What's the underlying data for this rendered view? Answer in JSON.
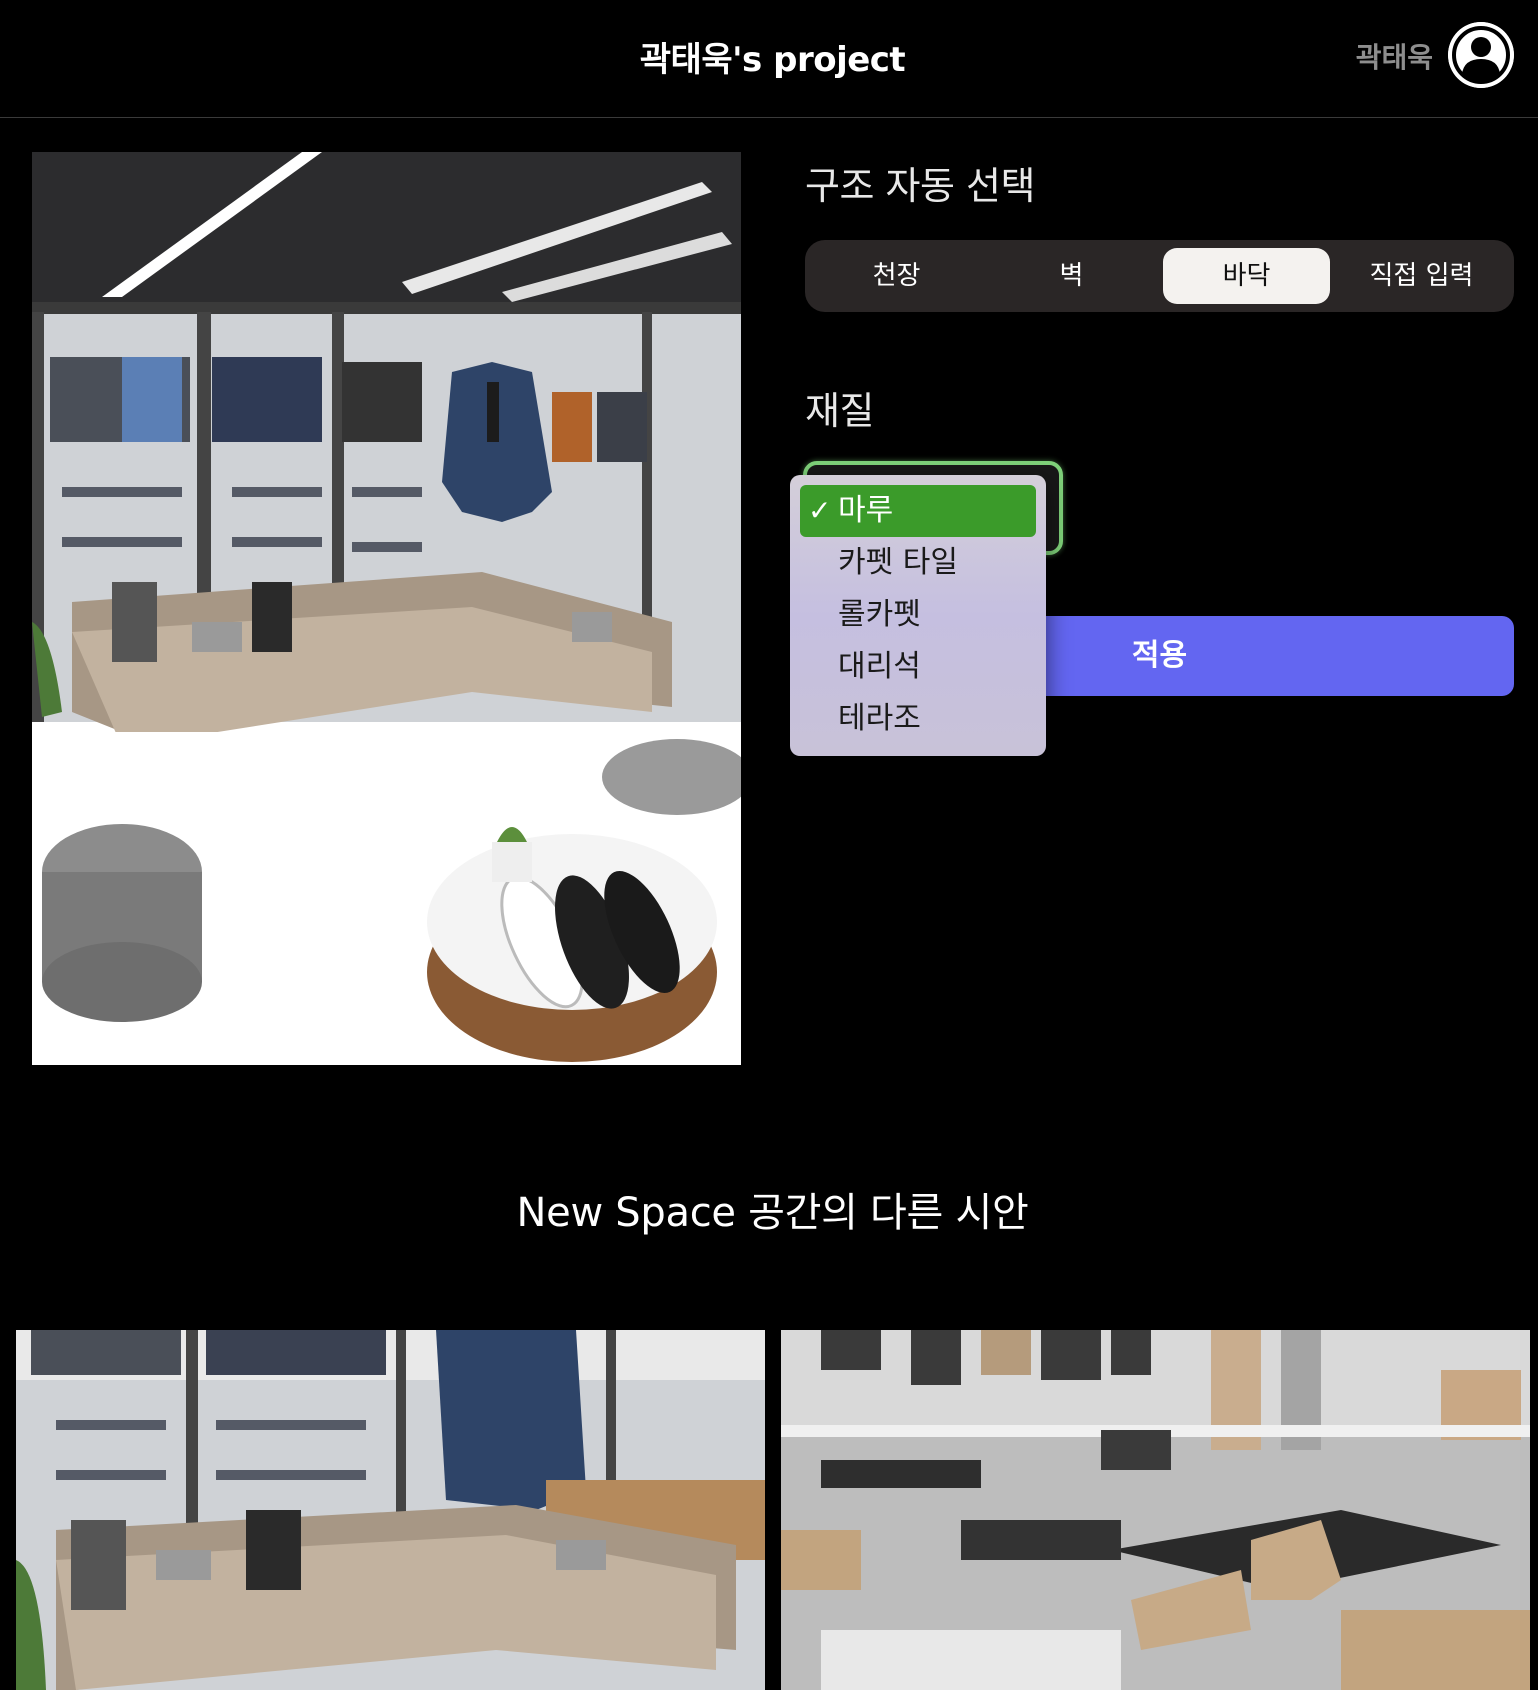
{
  "header": {
    "project_title": "곽태욱's project",
    "user_name": "곽태욱"
  },
  "structure": {
    "title": "구조 자동 선택",
    "tabs": [
      "천장",
      "벽",
      "바닥",
      "직접 입력"
    ],
    "active_tab": "바닥"
  },
  "material": {
    "title": "재질",
    "selected": "마루",
    "options": [
      "마루",
      "카펫 타일",
      "롤카펫",
      "대리석",
      "테라조"
    ]
  },
  "apply_label": "적용",
  "gallery": {
    "title": "New Space 공간의 다른 시안"
  },
  "colors": {
    "accent": "#6366f1",
    "selected_option": "#3b9b2a",
    "select_border": "#7fd27a"
  }
}
